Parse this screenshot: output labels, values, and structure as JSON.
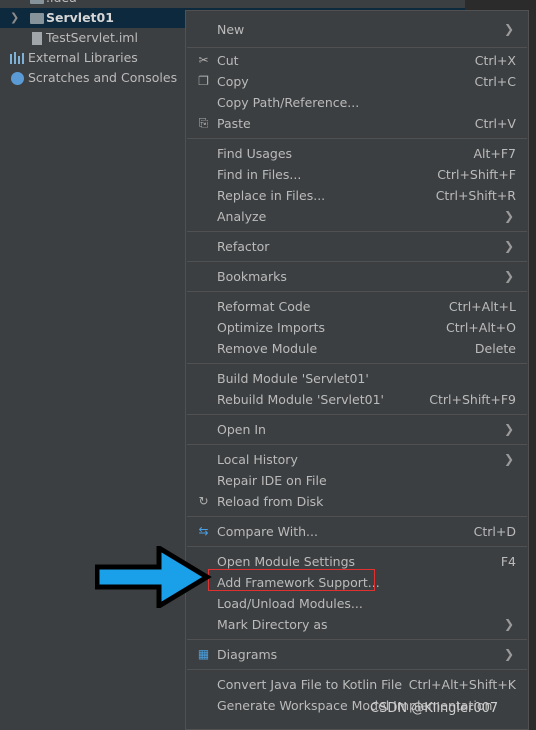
{
  "tree": {
    "items": [
      {
        "label": ".idea"
      },
      {
        "label": "Servlet01"
      },
      {
        "label": "TestServlet.iml"
      },
      {
        "label": "External Libraries"
      },
      {
        "label": "Scratches and Consoles"
      }
    ]
  },
  "menu": {
    "items": [
      {
        "label": "New",
        "shortcut": "",
        "submenu": true
      },
      {
        "label": "Cut",
        "shortcut": "Ctrl+X"
      },
      {
        "label": "Copy",
        "shortcut": "Ctrl+C"
      },
      {
        "label": "Copy Path/Reference...",
        "shortcut": ""
      },
      {
        "label": "Paste",
        "shortcut": "Ctrl+V"
      },
      {
        "label": "Find Usages",
        "shortcut": "Alt+F7"
      },
      {
        "label": "Find in Files...",
        "shortcut": "Ctrl+Shift+F"
      },
      {
        "label": "Replace in Files...",
        "shortcut": "Ctrl+Shift+R"
      },
      {
        "label": "Analyze",
        "shortcut": "",
        "submenu": true
      },
      {
        "label": "Refactor",
        "shortcut": "",
        "submenu": true
      },
      {
        "label": "Bookmarks",
        "shortcut": "",
        "submenu": true
      },
      {
        "label": "Reformat Code",
        "shortcut": "Ctrl+Alt+L"
      },
      {
        "label": "Optimize Imports",
        "shortcut": "Ctrl+Alt+O"
      },
      {
        "label": "Remove Module",
        "shortcut": "Delete"
      },
      {
        "label": "Build Module 'Servlet01'",
        "shortcut": ""
      },
      {
        "label": "Rebuild Module 'Servlet01'",
        "shortcut": "Ctrl+Shift+F9"
      },
      {
        "label": "Open In",
        "shortcut": "",
        "submenu": true
      },
      {
        "label": "Local History",
        "shortcut": "",
        "submenu": true
      },
      {
        "label": "Repair IDE on File",
        "shortcut": ""
      },
      {
        "label": "Reload from Disk",
        "shortcut": ""
      },
      {
        "label": "Compare With...",
        "shortcut": "Ctrl+D"
      },
      {
        "label": "Open Module Settings",
        "shortcut": "F4"
      },
      {
        "label": "Add Framework Support...",
        "shortcut": ""
      },
      {
        "label": "Load/Unload Modules...",
        "shortcut": ""
      },
      {
        "label": "Mark Directory as",
        "shortcut": "",
        "submenu": true
      },
      {
        "label": "Diagrams",
        "shortcut": "",
        "submenu": true
      },
      {
        "label": "Convert Java File to Kotlin File",
        "shortcut": "Ctrl+Alt+Shift+K"
      },
      {
        "label": "Generate Workspace Model Implementation",
        "shortcut": ""
      }
    ],
    "submenu_glyph": "❯"
  },
  "icons": {
    "cut": "✂",
    "copy": "❐",
    "paste": "⎘",
    "reload": "↻",
    "compare": "⇆",
    "diagrams": "▦",
    "tree_arrow": "❯"
  },
  "watermark": "CSDN @Klingler007",
  "colors": {
    "highlight_box": "#e03030",
    "arrow_fill": "#1aa0e8",
    "arrow_outline": "#000000"
  }
}
